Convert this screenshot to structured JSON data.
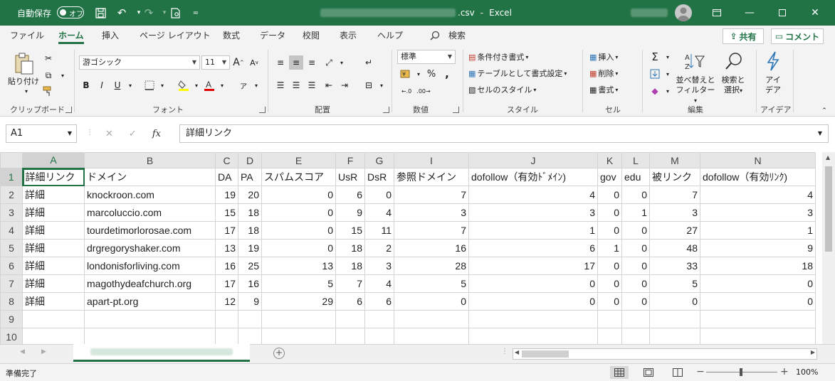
{
  "titlebar": {
    "autosave_label": "自動保存",
    "autosave_state": "オフ",
    "file_suffix": ".csv",
    "separator": "-",
    "app_name": "Excel"
  },
  "ribbon_tabs": [
    "ファイル",
    "ホーム",
    "挿入",
    "ページ レイアウト",
    "数式",
    "データ",
    "校閲",
    "表示",
    "ヘルプ"
  ],
  "search_label": "検索",
  "share_label": "共有",
  "comment_label": "コメント",
  "ribbon": {
    "clipboard": {
      "paste": "貼り付け",
      "label": "クリップボード"
    },
    "font": {
      "name": "游ゴシック",
      "size": "11",
      "label": "フォント",
      "grow": "A",
      "shrink": "A",
      "bold": "B",
      "italic": "I",
      "underline": "U"
    },
    "alignment": {
      "label": "配置"
    },
    "number": {
      "format": "標準",
      "label": "数値",
      "percent": "%",
      "comma": ","
    },
    "styles": {
      "conditional": "条件付き書式",
      "table": "テーブルとして書式設定",
      "cell_styles": "セルのスタイル",
      "label": "スタイル"
    },
    "cells": {
      "insert": "挿入",
      "delete": "削除",
      "format": "書式",
      "label": "セル"
    },
    "editing": {
      "sort": "並べ替えと",
      "filter": "フィルター",
      "find": "検索と",
      "select": "選択",
      "label": "編集"
    },
    "ideas": {
      "line1": "アイ",
      "line2": "デア",
      "label": "アイデア"
    }
  },
  "formula_bar": {
    "name_box": "A1",
    "fx": "fx",
    "content": "詳細リンク"
  },
  "columns": [
    "A",
    "B",
    "C",
    "D",
    "E",
    "F",
    "G",
    "I",
    "J",
    "K",
    "L",
    "M",
    "N"
  ],
  "header_row": [
    "詳細リンク",
    "ドメイン",
    "DA",
    "PA",
    "スパムスコア",
    "UsR",
    "DsR",
    "参照ドメイン",
    "dofollow（有効ﾄﾞﾒｲﾝ)",
    "gov",
    "edu",
    "被リンク",
    "dofollow（有効ﾘﾝｸ)"
  ],
  "rows": [
    [
      "詳細",
      "knockroon.com",
      "19",
      "20",
      "0",
      "6",
      "0",
      "7",
      "4",
      "0",
      "0",
      "7",
      "4"
    ],
    [
      "詳細",
      "marcoluccio.com",
      "15",
      "18",
      "0",
      "9",
      "4",
      "3",
      "3",
      "0",
      "1",
      "3",
      "3"
    ],
    [
      "詳細",
      "tourdetimorlorosae.com",
      "17",
      "18",
      "0",
      "15",
      "11",
      "7",
      "1",
      "0",
      "0",
      "27",
      "1"
    ],
    [
      "詳細",
      "drgregoryshaker.com",
      "13",
      "19",
      "0",
      "18",
      "2",
      "16",
      "6",
      "1",
      "0",
      "48",
      "9"
    ],
    [
      "詳細",
      "londonisforliving.com",
      "16",
      "25",
      "13",
      "18",
      "3",
      "28",
      "17",
      "0",
      "0",
      "33",
      "18"
    ],
    [
      "詳細",
      "magothydeafchurch.org",
      "17",
      "16",
      "5",
      "7",
      "4",
      "5",
      "0",
      "0",
      "0",
      "5",
      "0"
    ],
    [
      "詳細",
      "apart-pt.org",
      "12",
      "9",
      "29",
      "6",
      "6",
      "0",
      "0",
      "0",
      "0",
      "0",
      "0"
    ]
  ],
  "row_numbers": [
    "1",
    "2",
    "3",
    "4",
    "5",
    "6",
    "7",
    "8",
    "9",
    "10"
  ],
  "status": {
    "ready": "準備完了",
    "zoom": "100%",
    "minus": "−",
    "plus": "+"
  },
  "colors": {
    "accent": "#217346"
  }
}
